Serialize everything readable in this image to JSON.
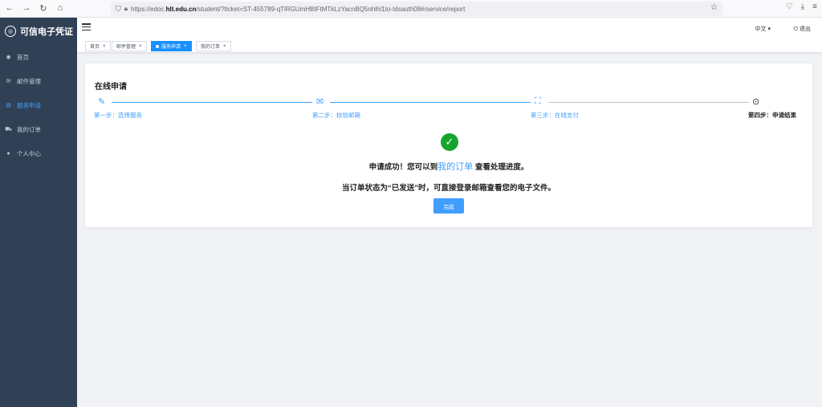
{
  "browser": {
    "url_prefix": "https://edoc.",
    "url_host": "hlt.edu.cn",
    "url_path": "/student/?ticket=ST-455789-qTlRGUmHBtFtMTkLzYacnBQ5nhlhl1to-Idsauth08#/service/report"
  },
  "sidebar": {
    "logo_text": "可信电子凭证",
    "items": [
      {
        "label": "首页"
      },
      {
        "label": "邮件管理"
      },
      {
        "label": "服务申请"
      },
      {
        "label": "我的订单"
      },
      {
        "label": "个人中心"
      }
    ]
  },
  "header": {
    "language": "中文",
    "logout": "退出"
  },
  "tags": [
    {
      "label": "首页"
    },
    {
      "label": "邮件管理"
    },
    {
      "label": "服务申请"
    },
    {
      "label": "我的订单"
    }
  ],
  "card": {
    "title": "在线申请",
    "steps": [
      {
        "label": "第一步：选择服务"
      },
      {
        "label": "第二步：校验邮箱"
      },
      {
        "label": "第三步：在线支付"
      },
      {
        "label": "第四步：申请结果"
      }
    ],
    "msg_prefix": "申请成功！您可以到",
    "msg_link": "我的订单",
    "msg_suffix": "查看处理进度。",
    "msg_line2": "当订单状态为“已发送”时，可直接登录邮箱查看您的电子文件。",
    "done_button": "完成"
  },
  "colors": {
    "sidebar_bg": "#304156",
    "accent": "#409eff",
    "success": "#15a52f"
  }
}
